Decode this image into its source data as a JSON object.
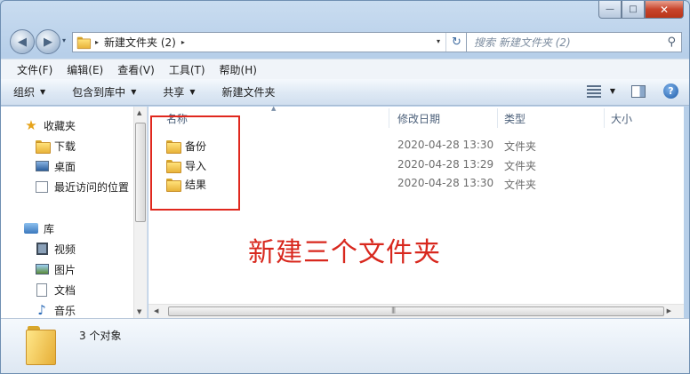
{
  "window": {
    "controls": {
      "minimize": "—",
      "maximize": "□",
      "close": "✕"
    }
  },
  "address": {
    "path": "新建文件夹 (2)",
    "separator": "▸",
    "dropdown": "▾",
    "refresh": "↻"
  },
  "nav_buttons": {
    "back": "◀",
    "forward": "▶",
    "drop": "▾"
  },
  "search": {
    "placeholder": "搜索 新建文件夹 (2)",
    "icon": "search-icon"
  },
  "menu": [
    "文件(F)",
    "编辑(E)",
    "查看(V)",
    "工具(T)",
    "帮助(H)"
  ],
  "toolbar": {
    "organize": "组织",
    "include_library": "包含到库中",
    "share": "共享",
    "new_folder": "新建文件夹",
    "arrow": "▼",
    "help": "?"
  },
  "sidebar": {
    "favorites": {
      "label": "收藏夹",
      "items": [
        "下载",
        "桌面",
        "最近访问的位置"
      ]
    },
    "libraries": {
      "label": "库",
      "items": [
        "视频",
        "图片",
        "文档",
        "音乐"
      ]
    }
  },
  "columns": {
    "name": "名称",
    "date": "修改日期",
    "type": "类型",
    "size": "大小",
    "sort_indicator": "▲"
  },
  "files": [
    {
      "name": "备份",
      "date": "2020-04-28 13:30",
      "type": "文件夹"
    },
    {
      "name": "导入",
      "date": "2020-04-28 13:29",
      "type": "文件夹"
    },
    {
      "name": "结果",
      "date": "2020-04-28 13:30",
      "type": "文件夹"
    }
  ],
  "annotation": "新建三个文件夹",
  "details": {
    "count": "3 个对象"
  },
  "scroll": {
    "up": "▲",
    "down": "▼",
    "left": "◀",
    "right": "▶",
    "grip": "|||"
  },
  "colors": {
    "annotation_red": "#d8281e",
    "folder_yellow": "#f3c44e",
    "window_blue": "#bcd3ea"
  }
}
